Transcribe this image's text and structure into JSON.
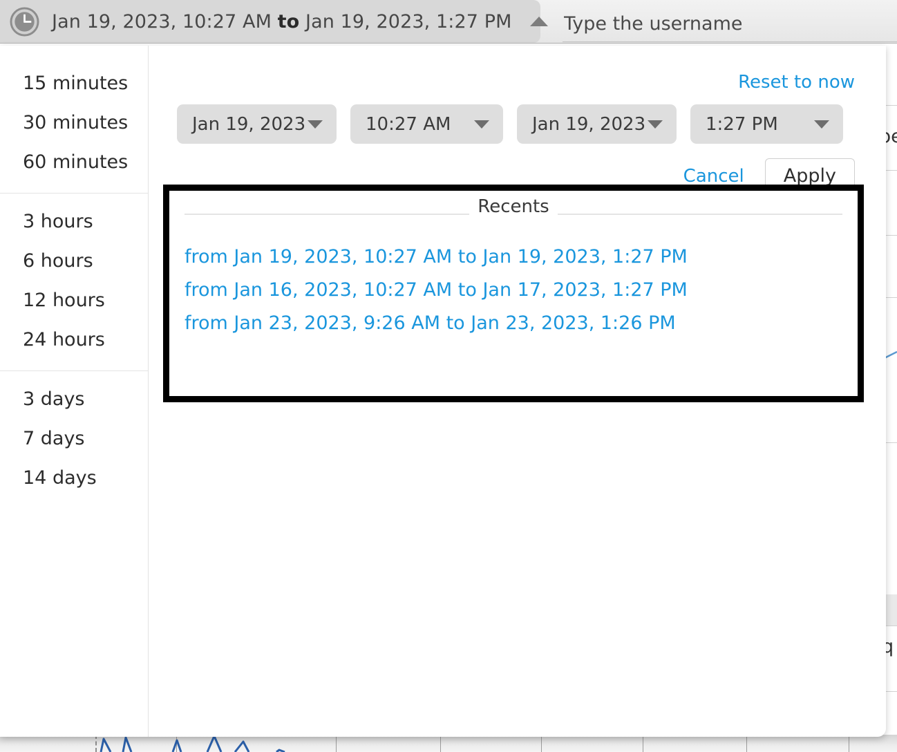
{
  "header": {
    "clock_icon": "clock-icon",
    "range_from": "Jan 19, 2023, 10:27 AM",
    "range_joiner": "to",
    "range_to": "Jan 19, 2023, 1:27 PM",
    "caret_icon": "chevron-up-icon"
  },
  "username": {
    "value": "",
    "placeholder": "Type the username"
  },
  "quick_ranges": [
    {
      "group": [
        "15 minutes",
        "30 minutes",
        "60 minutes"
      ]
    },
    {
      "group": [
        "3 hours",
        "6 hours",
        "12 hours",
        "24 hours"
      ]
    },
    {
      "group": [
        "3 days",
        "7 days",
        "14 days"
      ]
    }
  ],
  "picker": {
    "reset_label": "Reset to now",
    "fields": [
      {
        "name": "start-date",
        "value": "Jan 19, 2023",
        "kind": "date"
      },
      {
        "name": "start-time",
        "value": "10:27 AM",
        "kind": "time"
      },
      {
        "name": "end-date",
        "value": "Jan 19, 2023",
        "kind": "date"
      },
      {
        "name": "end-time",
        "value": "1:27 PM",
        "kind": "time"
      }
    ],
    "cancel_label": "Cancel",
    "apply_label": "Apply",
    "caret_icon": "chevron-down-icon"
  },
  "recents": {
    "legend": "Recents",
    "items": [
      "from Jan 19, 2023, 10:27 AM to Jan 19, 2023, 1:27 PM",
      "from Jan 16, 2023, 10:27 AM to Jan 17, 2023, 1:27 PM",
      "from Jan 23, 2023, 9:26 AM to Jan 23, 2023, 1:26 PM"
    ]
  },
  "background": {
    "partial_text_1": "pe",
    "partial_text_2": "q"
  },
  "colors": {
    "link_blue": "#1a96dd",
    "highlight_box": "#000000",
    "panel_bg": "#ffffff",
    "field_bg": "#dedede",
    "header_pill": "#d8d8d8",
    "chart_line": "#2b5fa8"
  }
}
